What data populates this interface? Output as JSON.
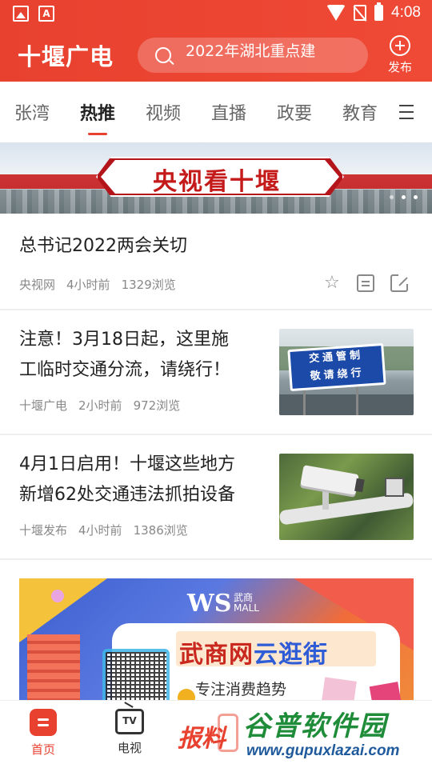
{
  "status_bar": {
    "time": "4:08",
    "app_icon_letter": "A"
  },
  "header": {
    "logo": "十堰广电",
    "search_placeholder": "2022年湖北重点建",
    "publish_label": "发布"
  },
  "tabs": [
    {
      "label": "张湾",
      "active": false
    },
    {
      "label": "热推",
      "active": true
    },
    {
      "label": "视频",
      "active": false
    },
    {
      "label": "直播",
      "active": false
    },
    {
      "label": "政要",
      "active": false
    },
    {
      "label": "教育",
      "active": false
    }
  ],
  "banner": {
    "title": "央视看十堰"
  },
  "articles": [
    {
      "title": "总书记2022两会关切",
      "source": "央视网",
      "time": "4小时前",
      "views": "1329浏览"
    },
    {
      "title_line1": "注意！3月18日起，这里施",
      "title_line2": "工临时交通分流，请绕行！",
      "source": "十堰广电",
      "time": "2小时前",
      "views": "972浏览",
      "thumb_sign_line1": "交通管制",
      "thumb_sign_line2": "敬请绕行"
    },
    {
      "title_line1": "4月1日启用！十堰这些地方",
      "title_line2": "新增62处交通违法抓拍设备",
      "source": "十堰发布",
      "time": "4小时前",
      "views": "1386浏览"
    }
  ],
  "ad": {
    "brand": "WS",
    "brand_cn": "武商",
    "brand_en": "MALL",
    "headline_part1": "武商网",
    "headline_part2": "云逛街",
    "tagline": "专注消费趋势"
  },
  "bottom_nav": {
    "home_label": "首页",
    "tv_label": "电视",
    "tv_icon_text": "TV",
    "report_label": "报料"
  },
  "watermark": {
    "title": "谷普软件园",
    "url": "www.gupuxlazai.com"
  },
  "colors": {
    "brand": "#e8412f",
    "ad_blue": "#2e5bd6"
  },
  "icons": [
    "gallery-icon",
    "app-a-icon",
    "wifi-icon",
    "no-sim-icon",
    "battery-icon",
    "search-icon",
    "plus-circle-icon",
    "menu-icon",
    "star-icon",
    "comment-icon",
    "share-icon",
    "home-icon",
    "tv-icon"
  ]
}
